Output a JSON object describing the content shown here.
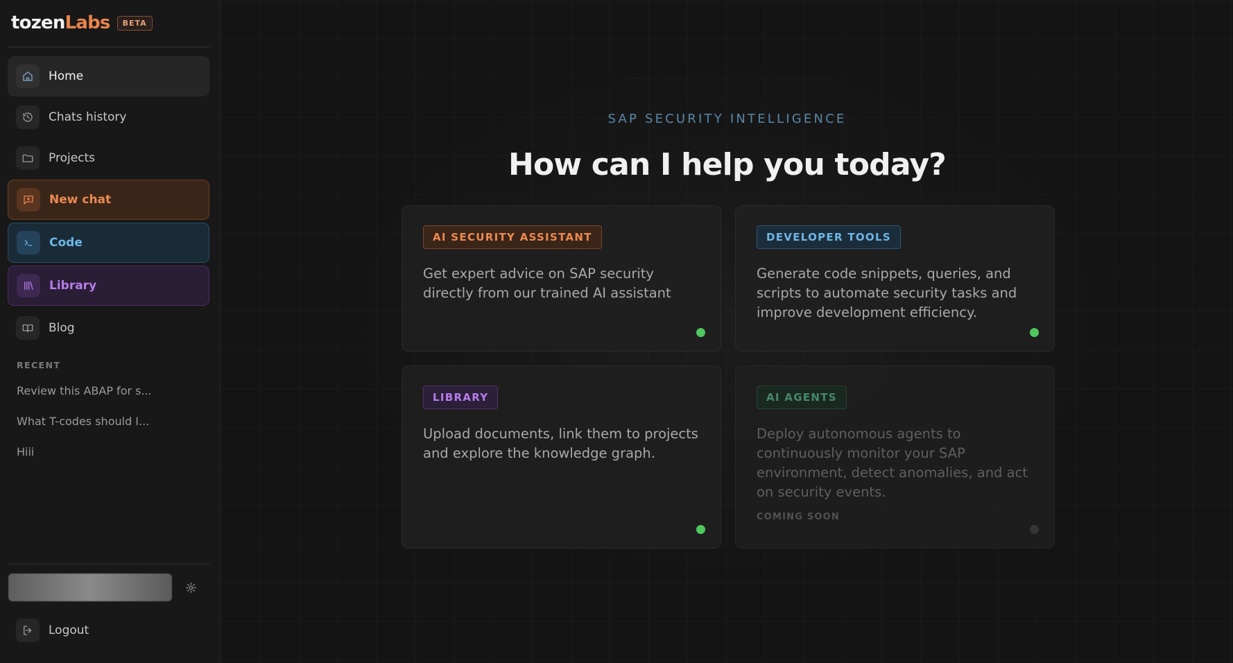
{
  "brand": {
    "name_a": "tozen",
    "name_b": "Labs",
    "badge": "BETA"
  },
  "nav": {
    "home": "Home",
    "chats_history": "Chats history",
    "projects": "Projects",
    "new_chat": "New chat",
    "code": "Code",
    "library": "Library",
    "blog": "Blog"
  },
  "recent": {
    "heading": "RECENT",
    "items": [
      "Review this ABAP for s...",
      "What T-codes should I...",
      "Hiii"
    ]
  },
  "footer": {
    "logout": "Logout"
  },
  "hero": {
    "eyebrow": "SAP SECURITY INTELLIGENCE",
    "title": "How can I help you today?"
  },
  "cards": [
    {
      "tag": "AI SECURITY ASSISTANT",
      "description": "Get expert advice on SAP security directly from our trained AI assistant",
      "status": "active"
    },
    {
      "tag": "DEVELOPER TOOLS",
      "description": "Generate code snippets, queries, and scripts to automate security tasks and improve development efficiency.",
      "status": "active"
    },
    {
      "tag": "LIBRARY",
      "description": "Upload documents, link them to projects and explore the knowledge graph.",
      "status": "active"
    },
    {
      "tag": "AI AGENTS",
      "description": "Deploy autonomous agents to continuously monitor your SAP environment, detect anomalies, and act on security events.",
      "note": "COMING SOON",
      "status": "inactive"
    }
  ],
  "colors": {
    "accent_orange": "#e8834c",
    "accent_blue": "#6fb6e6",
    "accent_purple": "#b57de8",
    "accent_green": "#4f9c79",
    "status_active": "#4fc85f"
  }
}
